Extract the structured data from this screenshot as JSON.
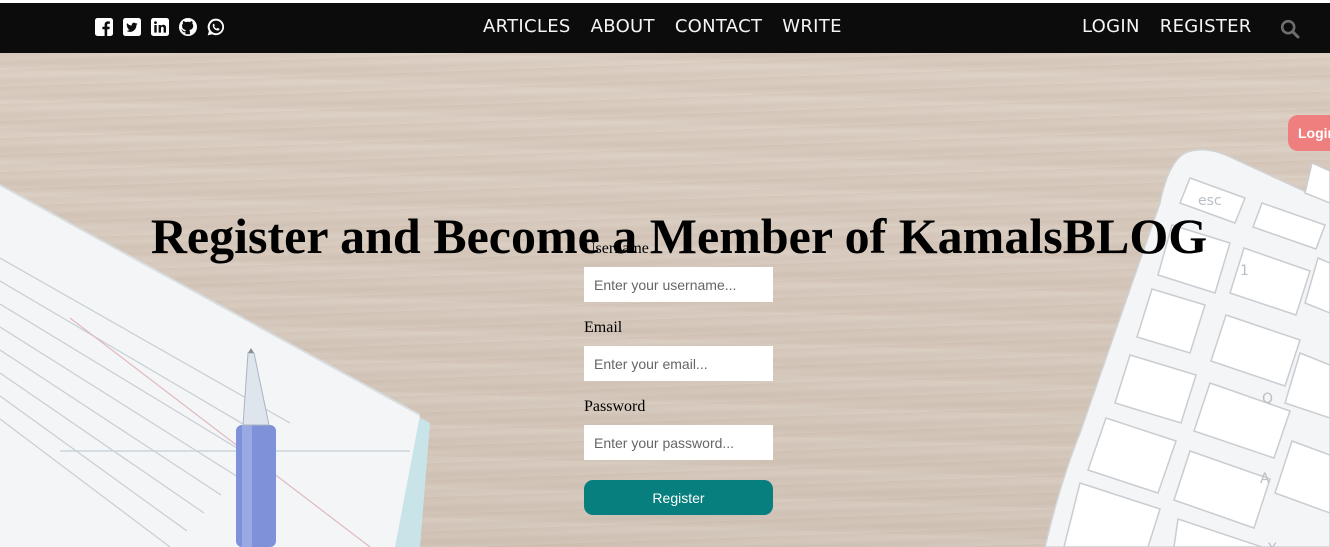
{
  "social": {
    "icons": [
      "facebook-icon",
      "twitter-icon",
      "linkedin-icon",
      "github-icon",
      "whatsapp-icon"
    ]
  },
  "nav": {
    "articles": "ARTICLES",
    "about": "ABOUT",
    "contact": "CONTACT",
    "write": "WRITE",
    "login": "LOGIN",
    "register": "REGISTER",
    "search_icon": "search-icon"
  },
  "side_login": {
    "label": "Login"
  },
  "hero": {
    "title": "Register and Become a Member of KamalsBLOG"
  },
  "form": {
    "username_label": "Username",
    "username_placeholder": "Enter your username...",
    "email_label": "Email",
    "email_placeholder": "Enter your email...",
    "password_label": "Password",
    "password_placeholder": "Enter your password...",
    "submit_label": "Register"
  },
  "colors": {
    "navbar": "#0c0c0c",
    "register_button": "#077f7f",
    "login_tab": "#ef7f7f"
  }
}
